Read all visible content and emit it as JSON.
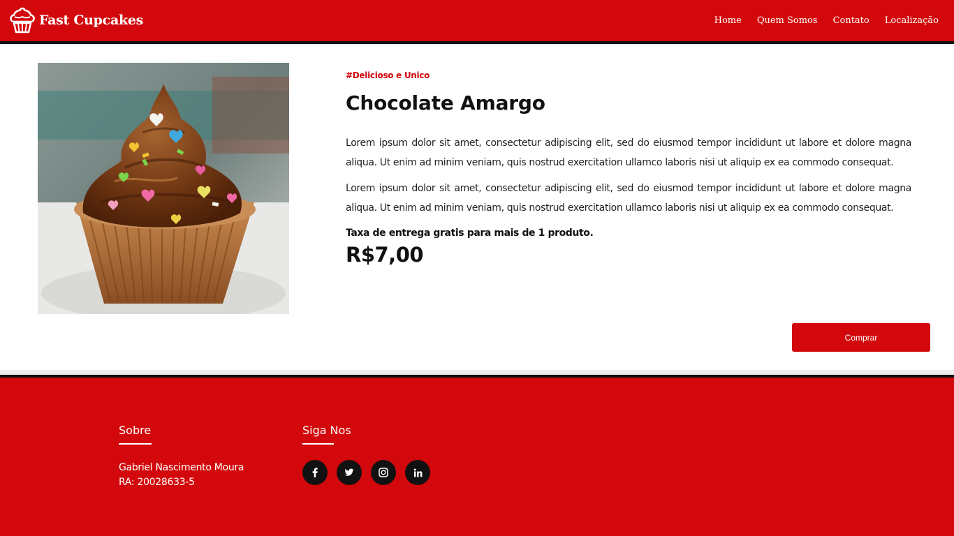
{
  "header": {
    "brand": "Fast Cupcakes",
    "nav": [
      "Home",
      "Quem Somos",
      "Contato",
      "Localização"
    ]
  },
  "product": {
    "tag": "#Delicioso e Unico",
    "title": "Chocolate Amargo",
    "description": [
      "Lorem ipsum dolor sit amet, consectetur adipiscing elit, sed do eiusmod tempor incididunt ut labore et dolore magna aliqua. Ut enim ad minim veniam, quis nostrud exercitation ullamco laboris nisi ut aliquip ex ea commodo consequat.",
      "Lorem ipsum dolor sit amet, consectetur adipiscing elit, sed do eiusmod tempor incididunt ut labore et dolore magna aliqua. Ut enim ad minim veniam, quis nostrud exercitation ullamco laboris nisi ut aliquip ex ea commodo consequat."
    ],
    "delivery_note": "Taxa de entrega gratis para mais de 1 produto.",
    "price": "R$7,00",
    "buy_label": "Comprar"
  },
  "footer": {
    "about": {
      "title": "Sobre",
      "lines": [
        "Gabriel Nascimento Moura",
        "RA: 20028633-5"
      ]
    },
    "social": {
      "title": "Siga Nos",
      "icons": [
        "facebook-icon",
        "twitter-icon",
        "instagram-icon",
        "linkedin-icon"
      ]
    }
  },
  "colors": {
    "brand_red": "#d2080c",
    "dark": "#111111"
  }
}
